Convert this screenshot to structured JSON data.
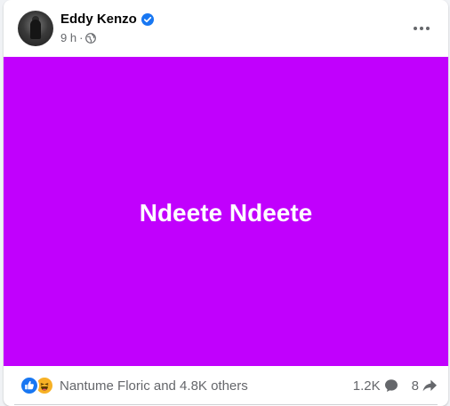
{
  "post": {
    "author": "Eddy Kenzo",
    "verified": true,
    "time": "9 h",
    "separator": "·",
    "audience_icon": "globe-icon",
    "more_icon": "more-horizontal-icon",
    "text": "Ndeete Ndeete",
    "background_color": "#c100fd"
  },
  "reactions": {
    "icons": [
      "like-icon",
      "haha-icon"
    ],
    "summary": "Nantume Floric and 4.8K others",
    "comments_count": "1.2K",
    "comments_icon": "comment-icon",
    "shares_count": "8",
    "shares_icon": "share-icon"
  },
  "colors": {
    "verified_blue": "#1877f2",
    "like_blue": "#1877f2",
    "haha_yellow": "#f7b125",
    "secondary_text": "#65676b"
  }
}
